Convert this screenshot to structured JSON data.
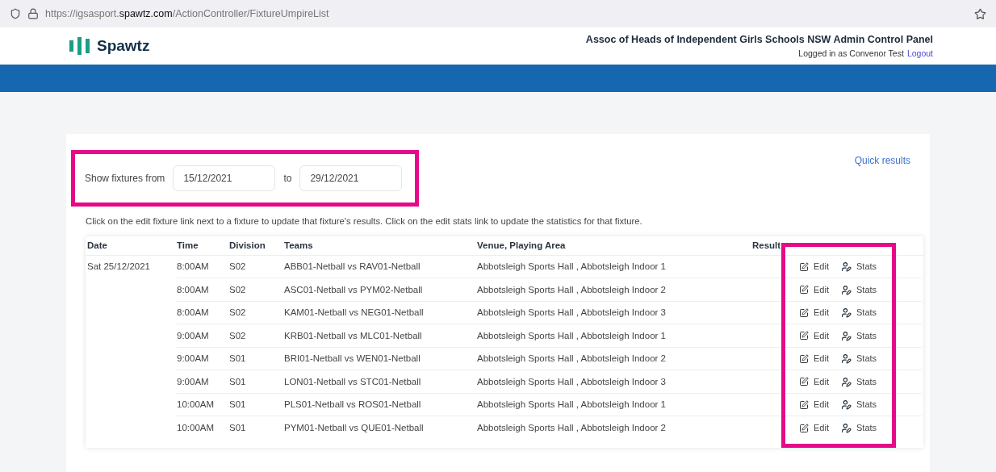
{
  "browser": {
    "url_host_prefix": "https://igsasport.",
    "url_host_domain": "spawtz.com",
    "url_path": "/ActionController/FixtureUmpireList"
  },
  "header": {
    "brand": "Spawtz",
    "title": "Assoc of Heads of Independent Girls Schools NSW Admin Control Panel",
    "login_text": "Logged in as Convenor Test",
    "logout_link": "Logout"
  },
  "filter": {
    "label": "Show fixtures from",
    "from": "15/12/2021",
    "to_label": "to",
    "to": "29/12/2021",
    "highlighted": true
  },
  "quick_results_link": "Quick results",
  "instructions": "Click on the edit fixture link next to a fixture to update that fixture's results. Click on the edit stats link to update the statistics for that fixture.",
  "table": {
    "columns": [
      "Date",
      "Time",
      "Division",
      "Teams",
      "Venue, Playing Area",
      "Result"
    ],
    "actions_highlighted": true,
    "rows": [
      {
        "date": "Sat 25/12/2021",
        "time": "8:00AM",
        "division": "S02",
        "teams": "ABB01-Netball vs RAV01-Netball",
        "venue": "Abbotsleigh Sports Hall , Abbotsleigh Indoor 1",
        "edit": "Edit",
        "stats": "Stats"
      },
      {
        "time": "8:00AM",
        "division": "S02",
        "teams": "ASC01-Netball vs PYM02-Netball",
        "venue": "Abbotsleigh Sports Hall , Abbotsleigh Indoor 2",
        "edit": "Edit",
        "stats": "Stats"
      },
      {
        "time": "8:00AM",
        "division": "S02",
        "teams": "KAM01-Netball vs NEG01-Netball",
        "venue": "Abbotsleigh Sports Hall , Abbotsleigh Indoor 3",
        "edit": "Edit",
        "stats": "Stats"
      },
      {
        "time": "9:00AM",
        "division": "S02",
        "teams": "KRB01-Netball vs MLC01-Netball",
        "venue": "Abbotsleigh Sports Hall , Abbotsleigh Indoor 1",
        "edit": "Edit",
        "stats": "Stats"
      },
      {
        "time": "9:00AM",
        "division": "S01",
        "teams": "BRI01-Netball vs WEN01-Netball",
        "venue": "Abbotsleigh Sports Hall , Abbotsleigh Indoor 2",
        "edit": "Edit",
        "stats": "Stats"
      },
      {
        "time": "9:00AM",
        "division": "S01",
        "teams": "LON01-Netball vs STC01-Netball",
        "venue": "Abbotsleigh Sports Hall , Abbotsleigh Indoor 3",
        "edit": "Edit",
        "stats": "Stats"
      },
      {
        "time": "10:00AM",
        "division": "S01",
        "teams": "PLS01-Netball vs ROS01-Netball",
        "venue": "Abbotsleigh Sports Hall , Abbotsleigh Indoor 1",
        "edit": "Edit",
        "stats": "Stats"
      },
      {
        "time": "10:00AM",
        "division": "S01",
        "teams": "PYM01-Netball vs QUE01-Netball",
        "venue": "Abbotsleigh Sports Hall , Abbotsleigh Indoor 2",
        "edit": "Edit",
        "stats": "Stats"
      }
    ]
  }
}
